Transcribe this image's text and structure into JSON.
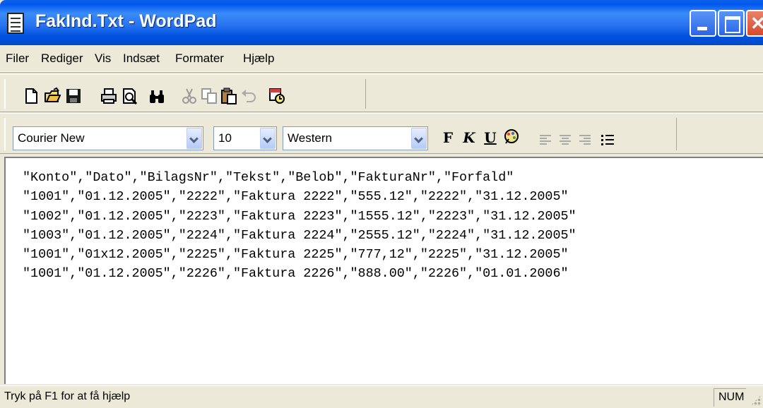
{
  "window": {
    "title": "FakInd.Txt - WordPad",
    "icon": "wordpad-document-icon"
  },
  "title_buttons": [
    {
      "name": "minimize-button",
      "icon": "minimize-icon"
    },
    {
      "name": "maximize-button",
      "icon": "maximize-icon"
    },
    {
      "name": "close-button",
      "icon": "close-icon"
    }
  ],
  "menu": {
    "items": [
      "Filer",
      "Rediger",
      "Vis",
      "Indsæt",
      "Formater",
      "Hjælp"
    ]
  },
  "toolbar": {
    "icons": [
      "new-document-icon",
      "open-folder-icon",
      "save-icon",
      "print-icon",
      "print-preview-icon",
      "find-icon",
      "cut-icon",
      "copy-icon",
      "paste-icon",
      "undo-icon",
      "insert-date-time-icon"
    ]
  },
  "format": {
    "font": "Courier New",
    "size": "10",
    "script": "Western",
    "bold_label": "F",
    "italic_label": "K",
    "underline_label": "U",
    "color_icon": "color-palette-icon",
    "align_icons": [
      "align-left-icon",
      "align-center-icon",
      "align-right-icon",
      "bullets-icon"
    ]
  },
  "document": {
    "lines": [
      "\"Konto\",\"Dato\",\"BilagsNr\",\"Tekst\",\"Belob\",\"FakturaNr\",\"Forfald\"",
      "\"1001\",\"01.12.2005\",\"2222\",\"Faktura 2222\",\"555.12\",\"2222\",\"31.12.2005\"",
      "\"1002\",\"01.12.2005\",\"2223\",\"Faktura 2223\",\"1555.12\",\"2223\",\"31.12.2005\"",
      "\"1003\",\"01.12.2005\",\"2224\",\"Faktura 2224\",\"2555.12\",\"2224\",\"31.12.2005\"",
      "\"1001\",\"01x12.2005\",\"2225\",\"Faktura 2225\",\"777,12\",\"2225\",\"31.12.2005\"",
      "\"1001\",\"01.12.2005\",\"2226\",\"Faktura 2226\",\"888.00\",\"2226\",\"01.01.2006\""
    ]
  },
  "status": {
    "text": "Tryk på F1 for at få hjælp",
    "num": "NUM"
  }
}
